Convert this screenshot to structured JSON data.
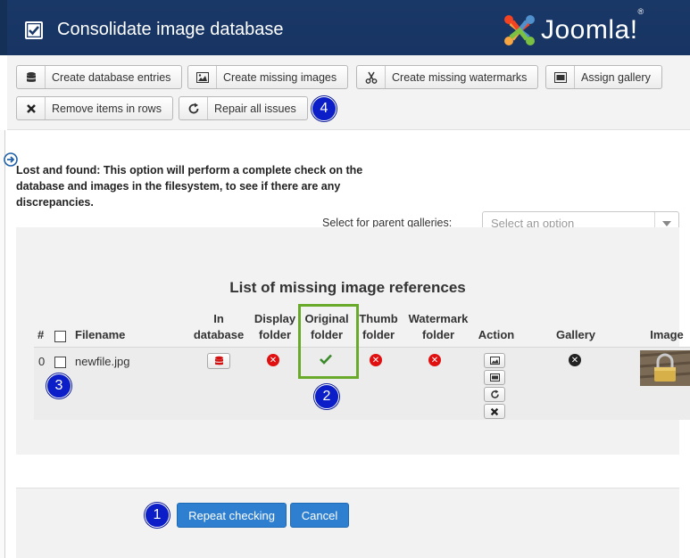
{
  "header": {
    "title": "Consolidate image database",
    "logo_text": "Joomla!",
    "logo_registered": "®"
  },
  "toolbar": {
    "buttons": [
      {
        "label": "Create database entries",
        "icon": "database-icon"
      },
      {
        "label": "Create missing images",
        "icon": "image-icon"
      },
      {
        "label": "Create missing watermarks",
        "icon": "scissors-icon"
      },
      {
        "label": "Assign gallery",
        "icon": "gallery-icon"
      },
      {
        "label": "Remove items in rows",
        "icon": "close-icon"
      },
      {
        "label": "Repair all issues",
        "icon": "refresh-icon"
      }
    ]
  },
  "badges": {
    "one": "1",
    "two": "2",
    "three": "3",
    "four": "4"
  },
  "description": "Lost and found: This option will perform a complete check on the database and images in the filesystem, to see if there are any discrepancies.",
  "parent_gallery": {
    "label": "Select for parent galleries:",
    "placeholder": "Select an option"
  },
  "table": {
    "title": "List of missing image references",
    "columns": {
      "num": "#",
      "filename": "Filename",
      "in_database": [
        "In",
        "database"
      ],
      "display_folder": [
        "Display",
        "folder"
      ],
      "original_folder": [
        "Original",
        "folder"
      ],
      "thumb_folder": [
        "Thumb",
        "folder"
      ],
      "watermark_folder": [
        "Watermark",
        "folder"
      ],
      "action": "Action",
      "gallery": "Gallery",
      "image": "Image"
    },
    "rows": [
      {
        "num": "0",
        "filename": "newfile.jpg",
        "in_database": "button",
        "display_folder": "missing",
        "original_folder": "present",
        "thumb_folder": "missing",
        "watermark_folder": "missing",
        "gallery": "none"
      }
    ]
  },
  "colors": {
    "header_bg": "#1a3867",
    "primary_button": "#2e7fd0",
    "badge": "#0b1ec7",
    "highlight": "#6aaa2a",
    "missing": "#e01010",
    "present": "#3a8a2a"
  },
  "footer": {
    "repeat_label": "Repeat checking",
    "cancel_label": "Cancel"
  }
}
